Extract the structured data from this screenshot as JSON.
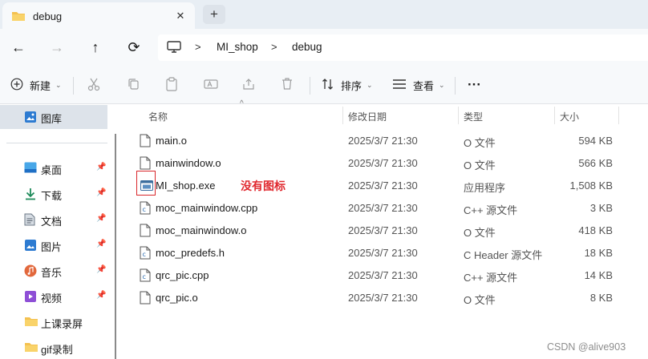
{
  "tab": {
    "title": "debug",
    "close_glyph": "✕",
    "new_tab_glyph": "+"
  },
  "nav": {
    "back": "←",
    "forward": "→",
    "up": "↑",
    "refresh": "⟳"
  },
  "address": {
    "crumbs": [
      "MI_shop",
      "debug"
    ],
    "separator": ">"
  },
  "commands": {
    "new_label": "新建",
    "sort_label": "排序",
    "view_label": "查看",
    "more": "···"
  },
  "sidebar": {
    "top_item": "图库",
    "items": [
      {
        "label": "桌面",
        "icon": "desktop-icon",
        "pinned": true
      },
      {
        "label": "下载",
        "icon": "download-icon",
        "pinned": true
      },
      {
        "label": "文档",
        "icon": "document-icon",
        "pinned": true
      },
      {
        "label": "图片",
        "icon": "pictures-icon",
        "pinned": true
      },
      {
        "label": "音乐",
        "icon": "music-icon",
        "pinned": true
      },
      {
        "label": "视频",
        "icon": "video-icon",
        "pinned": true
      },
      {
        "label": "上课录屏",
        "icon": "folder-icon",
        "pinned": false
      },
      {
        "label": "gif录制",
        "icon": "folder-icon",
        "pinned": false
      }
    ]
  },
  "columns": {
    "name": "名称",
    "date": "修改日期",
    "type": "类型",
    "size": "大小"
  },
  "files": [
    {
      "name": "main.o",
      "date": "2025/3/7 21:30",
      "type": "O 文件",
      "size": "594 KB",
      "icon": "file-icon"
    },
    {
      "name": "mainwindow.o",
      "date": "2025/3/7 21:30",
      "type": "O 文件",
      "size": "566 KB",
      "icon": "file-icon"
    },
    {
      "name": "MI_shop.exe",
      "date": "2025/3/7 21:30",
      "type": "应用程序",
      "size": "1,508 KB",
      "icon": "exe-icon"
    },
    {
      "name": "moc_mainwindow.cpp",
      "date": "2025/3/7 21:30",
      "type": "C++ 源文件",
      "size": "3 KB",
      "icon": "cpp-file-icon"
    },
    {
      "name": "moc_mainwindow.o",
      "date": "2025/3/7 21:30",
      "type": "O 文件",
      "size": "418 KB",
      "icon": "file-icon"
    },
    {
      "name": "moc_predefs.h",
      "date": "2025/3/7 21:30",
      "type": "C Header 源文件",
      "size": "18 KB",
      "icon": "header-file-icon"
    },
    {
      "name": "qrc_pic.cpp",
      "date": "2025/3/7 21:30",
      "type": "C++ 源文件",
      "size": "14 KB",
      "icon": "cpp-file-icon"
    },
    {
      "name": "qrc_pic.o",
      "date": "2025/3/7 21:30",
      "type": "O 文件",
      "size": "8 KB",
      "icon": "file-icon"
    }
  ],
  "annotation": {
    "text": "没有图标",
    "color": "#e0282e"
  },
  "watermark": "CSDN @alive903",
  "colors": {
    "accent": "#0067c0",
    "selected_bg": "#dde3ea",
    "chrome_bg": "#f7f9fb"
  }
}
